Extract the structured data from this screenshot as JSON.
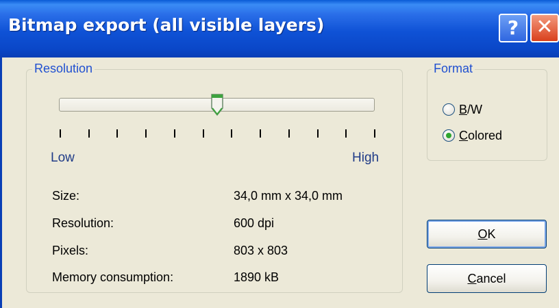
{
  "window": {
    "title": "Bitmap export (all visible layers)",
    "help_glyph": "?",
    "close_glyph": "✕"
  },
  "resolution_group": {
    "legend": "Resolution",
    "slider": {
      "min_label": "Low",
      "max_label": "High",
      "level": 0.5,
      "tick_count": 12
    },
    "info": [
      {
        "label": "Size:",
        "value": "34,0 mm x 34,0 mm"
      },
      {
        "label": "Resolution:",
        "value": "600 dpi"
      },
      {
        "label": "Pixels:",
        "value": "803 x 803"
      },
      {
        "label": "Memory consumption:",
        "value": "1890 kB"
      }
    ]
  },
  "format_group": {
    "legend": "Format",
    "options": [
      {
        "label": "B/W",
        "selected": false
      },
      {
        "label": "Colored",
        "selected": true
      }
    ]
  },
  "buttons": {
    "ok": "OK",
    "cancel": "Cancel"
  },
  "colors": {
    "titlebar": "#0a47c8",
    "dialog_bg": "#ece9d8",
    "legend_text": "#2050d0",
    "radio_selected": "#2fa52f"
  },
  "icons": {
    "help": "help-icon",
    "close": "close-icon",
    "slider_thumb": "slider-thumb-icon"
  }
}
